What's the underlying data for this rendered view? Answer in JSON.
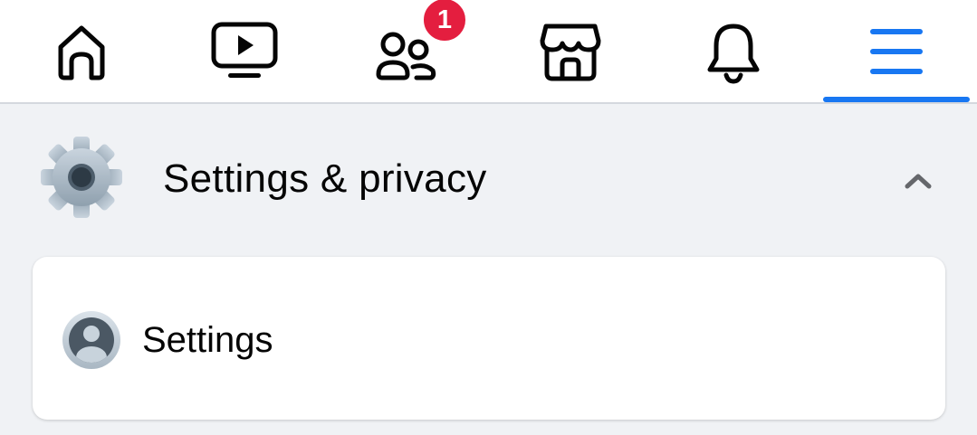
{
  "nav": {
    "tabs": [
      {
        "icon": "home-icon"
      },
      {
        "icon": "video-icon"
      },
      {
        "icon": "friends-icon",
        "badge": "1"
      },
      {
        "icon": "marketplace-icon"
      },
      {
        "icon": "notifications-icon"
      },
      {
        "icon": "menu-icon",
        "active": true
      }
    ],
    "active_color": "#1877f2",
    "badge_color": "#e41e3f"
  },
  "section": {
    "title": "Settings & privacy",
    "icon": "gear-icon",
    "expanded": true
  },
  "items": [
    {
      "label": "Settings",
      "icon": "user-avatar-icon"
    }
  ]
}
